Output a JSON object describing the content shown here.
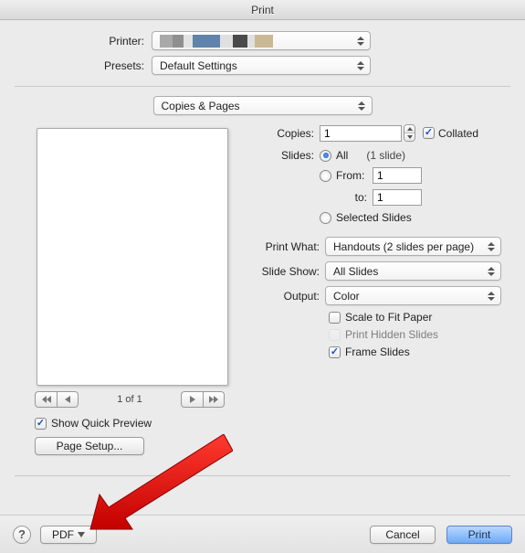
{
  "title": "Print",
  "labels": {
    "printer": "Printer:",
    "presets": "Presets:",
    "copies": "Copies:",
    "collated": "Collated",
    "slides": "Slides:",
    "all": "All",
    "slide_count": "(1 slide)",
    "from": "From:",
    "to": "to:",
    "selected": "Selected Slides",
    "print_what": "Print What:",
    "slide_show": "Slide Show:",
    "output": "Output:",
    "scale": "Scale to Fit Paper",
    "hidden": "Print Hidden Slides",
    "frame": "Frame Slides",
    "page_of": "1 of 1",
    "quick_preview": "Show Quick Preview",
    "page_setup": "Page Setup...",
    "pdf": "PDF",
    "cancel": "Cancel",
    "print": "Print"
  },
  "values": {
    "presets": "Default Settings",
    "section": "Copies & Pages",
    "copies": "1",
    "from": "1",
    "to": "1",
    "print_what": "Handouts (2 slides per page)",
    "slide_show": "All Slides",
    "output": "Color"
  },
  "checks": {
    "collated": true,
    "scale": false,
    "hidden": false,
    "frame": true,
    "quick_preview": true
  },
  "radio": {
    "all": true,
    "from": false,
    "selected": false
  }
}
